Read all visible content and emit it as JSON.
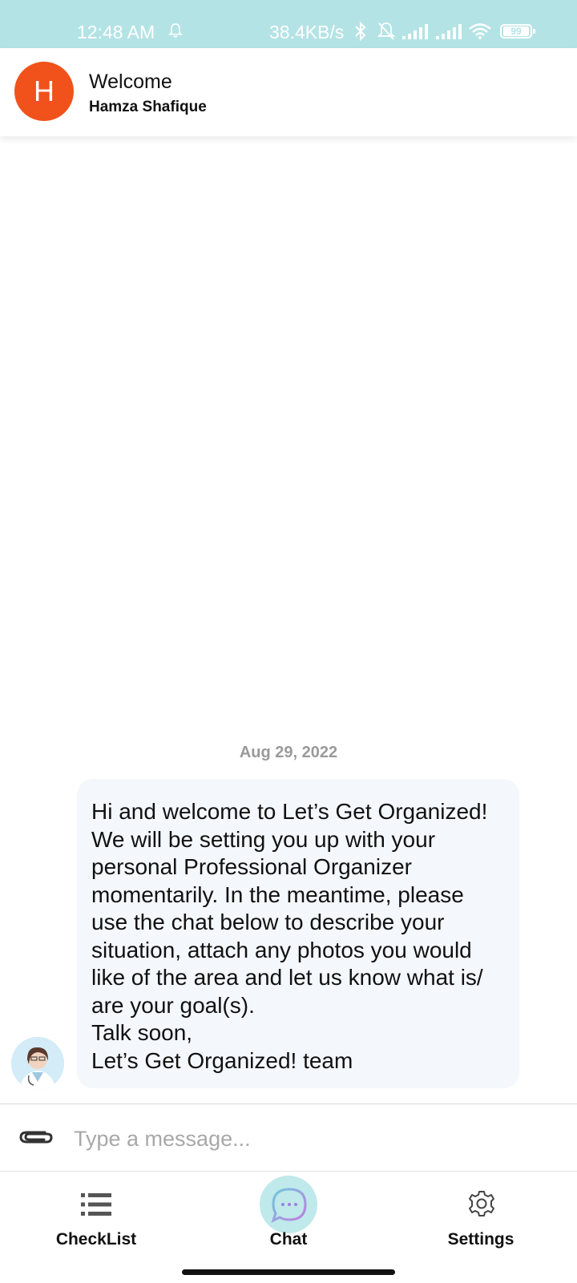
{
  "status_bar": {
    "time": "12:48 AM",
    "net_speed": "38.4KB/s",
    "battery": "99",
    "icons": [
      "bell-icon",
      "bluetooth-icon",
      "mute-icon",
      "signal-icon",
      "signal-icon",
      "wifi-icon",
      "battery-icon"
    ]
  },
  "header": {
    "avatar_letter": "H",
    "avatar_color": "#f1511b",
    "welcome": "Welcome",
    "username": "Hamza Shafique"
  },
  "chat": {
    "date": "Aug 29, 2022",
    "messages": [
      {
        "text": "Hi and welcome to Let’s Get Organized!\nWe will be setting you up with your\npersonal Professional Organizer\nmomentarily. In the meantime, please\nuse the chat below to describe your\nsituation, attach any photos you would\nlike of the area and let us know what is/\nare your goal(s).\nTalk soon,\n Let’s Get Organized! team"
      }
    ]
  },
  "composer": {
    "placeholder": "Type a message...",
    "value": ""
  },
  "bottom_nav": {
    "items": [
      {
        "label": "CheckList",
        "icon": "checklist-icon"
      },
      {
        "label": "Chat",
        "icon": "chat-icon",
        "active": true
      },
      {
        "label": "Settings",
        "icon": "gear-icon"
      }
    ]
  },
  "colors": {
    "status_bar": "#b4e3e5",
    "bubble": "#f4f7fb",
    "chat_active": "#bfe9ea"
  }
}
